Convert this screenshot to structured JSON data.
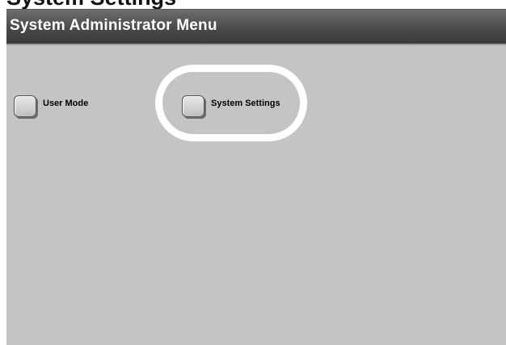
{
  "header": {
    "title": "System Administrator Menu"
  },
  "options": {
    "user_mode": {
      "label": "User Mode"
    },
    "system_settings": {
      "label": "System Settings",
      "highlighted": true
    }
  },
  "colors": {
    "title_bar": "#4a4a4a",
    "panel_background": "#c4c4c4",
    "highlight_ring": "#ffffff"
  }
}
